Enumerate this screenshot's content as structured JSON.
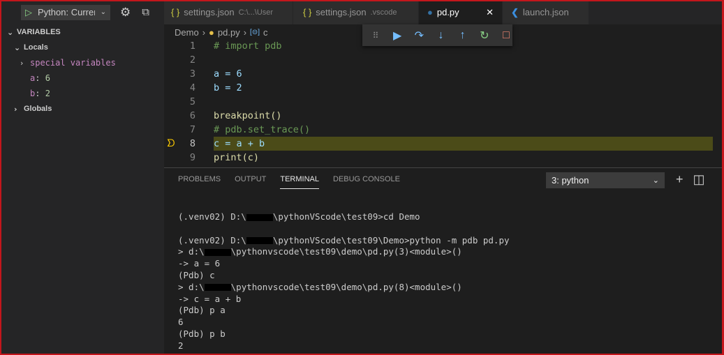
{
  "debug": {
    "config": "Python: Current File"
  },
  "sidebar": {
    "section": "VARIABLES",
    "locals": "Locals",
    "special": "special variables",
    "vars": [
      {
        "name": "a",
        "value": "6"
      },
      {
        "name": "b",
        "value": "2"
      }
    ],
    "globals": "Globals"
  },
  "tabs": [
    {
      "label": "settings.json",
      "desc": "C:\\...\\User",
      "icon": "braces"
    },
    {
      "label": "settings.json",
      "desc": ".vscode",
      "icon": "braces"
    },
    {
      "label": "pd.py",
      "desc": "",
      "icon": "python",
      "active": true
    },
    {
      "label": "launch.json",
      "desc": "",
      "icon": "vscode"
    }
  ],
  "breadcrumb": {
    "folder": "Demo",
    "file": "pd.py",
    "symbol": "c"
  },
  "code": {
    "current_line": 8,
    "lines": [
      "# import pdb",
      "",
      "a = 6",
      "b = 2",
      "",
      "breakpoint()",
      "# pdb.set_trace()",
      "c = a + b",
      "print(c)"
    ]
  },
  "panel": {
    "tabs": [
      "PROBLEMS",
      "OUTPUT",
      "TERMINAL",
      "DEBUG CONSOLE"
    ],
    "active": "TERMINAL",
    "terminal_select": "3: python"
  },
  "terminal": [
    {
      "pre": "(.venv02) D:\\",
      "post": "\\pythonVScode\\test09>cd Demo"
    },
    {
      "pre": ""
    },
    {
      "pre": "(.venv02) D:\\",
      "post": "\\pythonVScode\\test09\\Demo>python -m pdb pd.py"
    },
    {
      "pre": "> d:\\",
      "post": "\\pythonvscode\\test09\\demo\\pd.py(3)<module>()"
    },
    {
      "pre": "-> a = 6"
    },
    {
      "pre": "(Pdb) c"
    },
    {
      "pre": "> d:\\",
      "post": "\\pythonvscode\\test09\\demo\\pd.py(8)<module>()"
    },
    {
      "pre": "-> c = a + b"
    },
    {
      "pre": "(Pdb) p a"
    },
    {
      "pre": "6"
    },
    {
      "pre": "(Pdb) p b"
    },
    {
      "pre": "2"
    }
  ]
}
